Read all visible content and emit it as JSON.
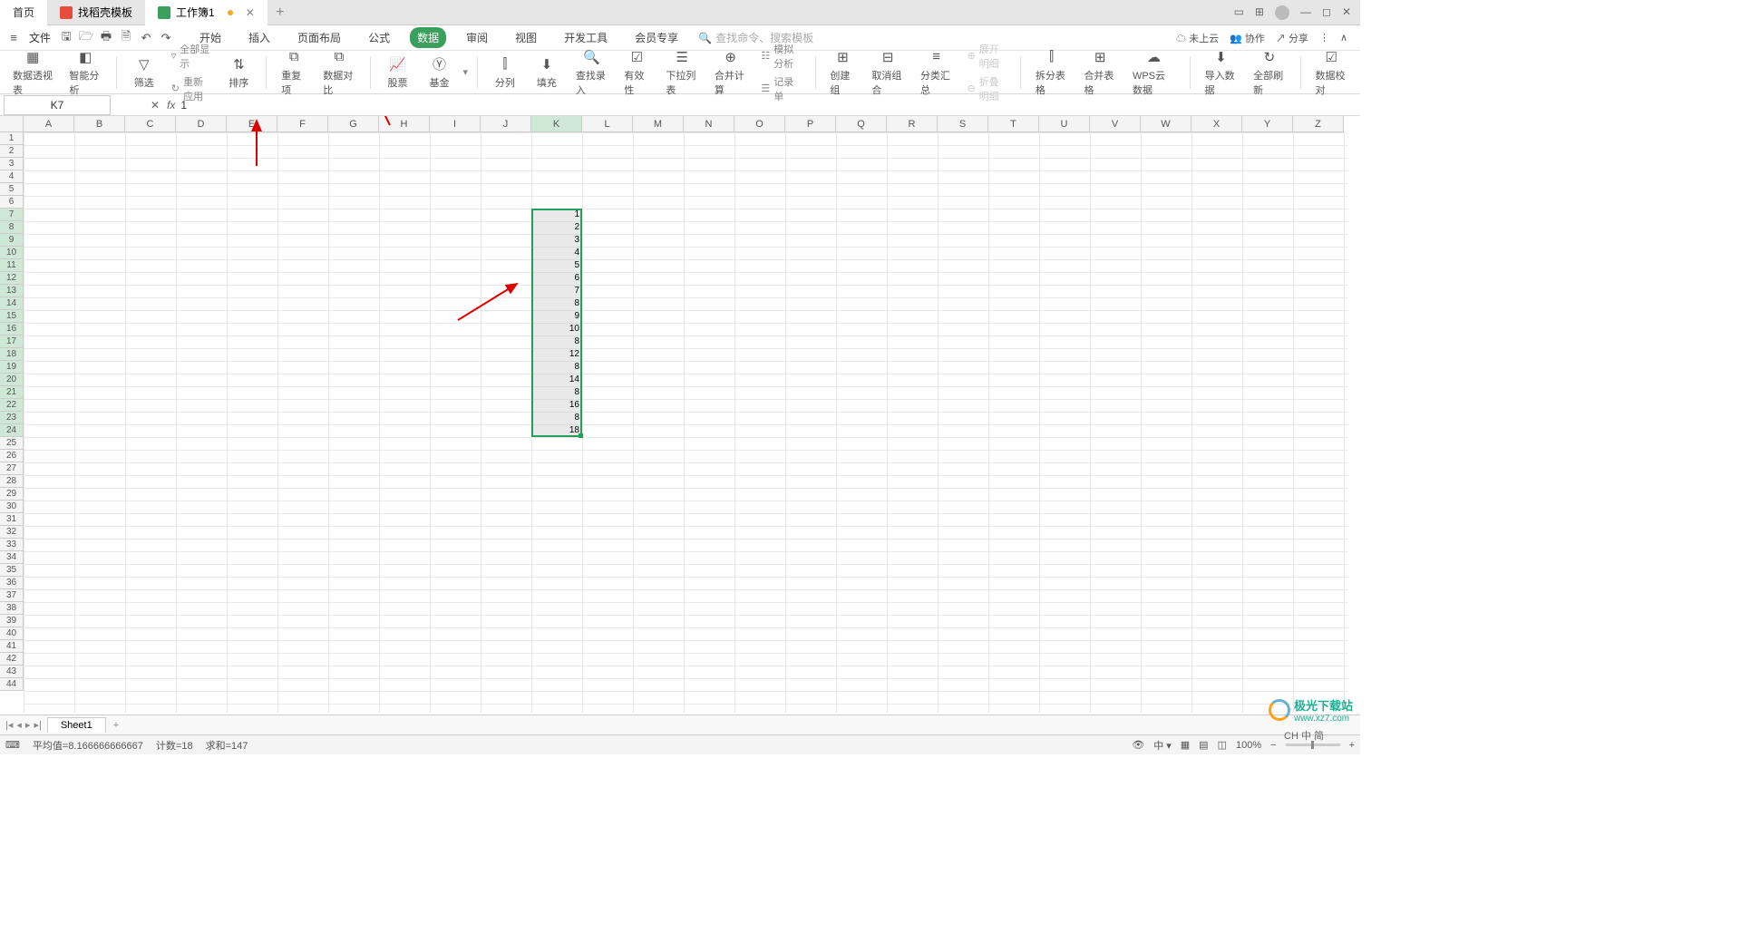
{
  "tabs": {
    "home": "首页",
    "t1": "找稻壳模板",
    "t2": "工作簿1"
  },
  "file_menu": "文件",
  "menu": {
    "start": "开始",
    "insert": "插入",
    "layout": "页面布局",
    "formula": "公式",
    "data": "数据",
    "review": "审阅",
    "view": "视图",
    "dev": "开发工具",
    "vip": "会员专享"
  },
  "search_ph": "查找命令、搜索模板",
  "cloud": "未上云",
  "coop": "协作",
  "share": "分享",
  "ribbon": {
    "pivot": "数据透视表",
    "smart": "智能分析",
    "filter": "筛选",
    "showall": "全部显示",
    "reapply": "重新应用",
    "sort": "排序",
    "dup": "重复项",
    "compare": "数据对比",
    "stock": "股票",
    "fund": "基金",
    "split": "分列",
    "fill": "填充",
    "lookup": "查找录入",
    "valid": "有效性",
    "dropdown": "下拉列表",
    "consol": "合并计算",
    "sim": "模拟分析",
    "form": "记录单",
    "group": "创建组",
    "ungroup": "取消组合",
    "subtotal": "分类汇总",
    "expand": "展开明细",
    "collapse": "折叠明细",
    "splittbl": "拆分表格",
    "mergetbl": "合并表格",
    "wpscloud": "WPS云数据",
    "import": "导入数据",
    "refresh": "全部刷新",
    "dcheck": "数据校对"
  },
  "namebox": "K7",
  "fx_val": "1",
  "cols": [
    "A",
    "B",
    "C",
    "D",
    "E",
    "F",
    "G",
    "H",
    "I",
    "J",
    "K",
    "L",
    "M",
    "N",
    "O",
    "P",
    "Q",
    "R",
    "S",
    "T",
    "U",
    "V",
    "W",
    "X",
    "Y",
    "Z"
  ],
  "rows": 44,
  "sel": {
    "col": 10,
    "row_start": 6,
    "row_end": 23
  },
  "values": [
    "1",
    "2",
    "3",
    "4",
    "5",
    "6",
    "7",
    "8",
    "9",
    "10",
    "8",
    "12",
    "8",
    "14",
    "8",
    "16",
    "8",
    "18"
  ],
  "sheet": "Sheet1",
  "status": {
    "avg": "平均值=8.166666666667",
    "count": "计数=18",
    "sum": "求和=147",
    "zoom": "100%"
  },
  "watermark": {
    "t1": "极光下载站",
    "t2": "www.xz7.com"
  },
  "ime": "CH 中 简"
}
